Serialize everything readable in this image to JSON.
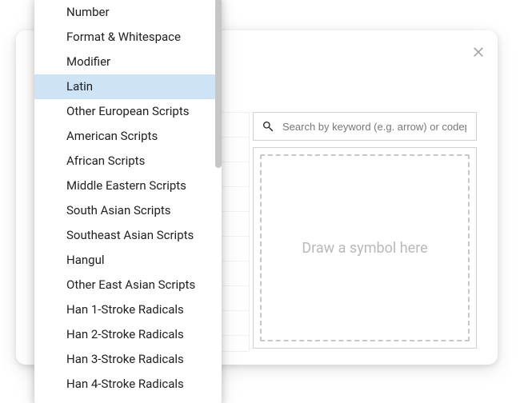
{
  "close_icon_name": "close-icon",
  "search": {
    "placeholder": "Search by keyword (e.g. arrow) or codepoint"
  },
  "draw_area": {
    "placeholder": "Draw a symbol here"
  },
  "categories": {
    "selected_index": 3,
    "items": [
      "Number",
      "Format & Whitespace",
      "Modifier",
      "Latin",
      "Other European Scripts",
      "American Scripts",
      "African Scripts",
      "Middle Eastern Scripts",
      "South Asian Scripts",
      "Southeast Asian Scripts",
      "Hangul",
      "Other East Asian Scripts",
      "Han 1-Stroke Radicals",
      "Han 2-Stroke Radicals",
      "Han 3-Stroke Radicals",
      "Han 4-Stroke Radicals"
    ]
  }
}
